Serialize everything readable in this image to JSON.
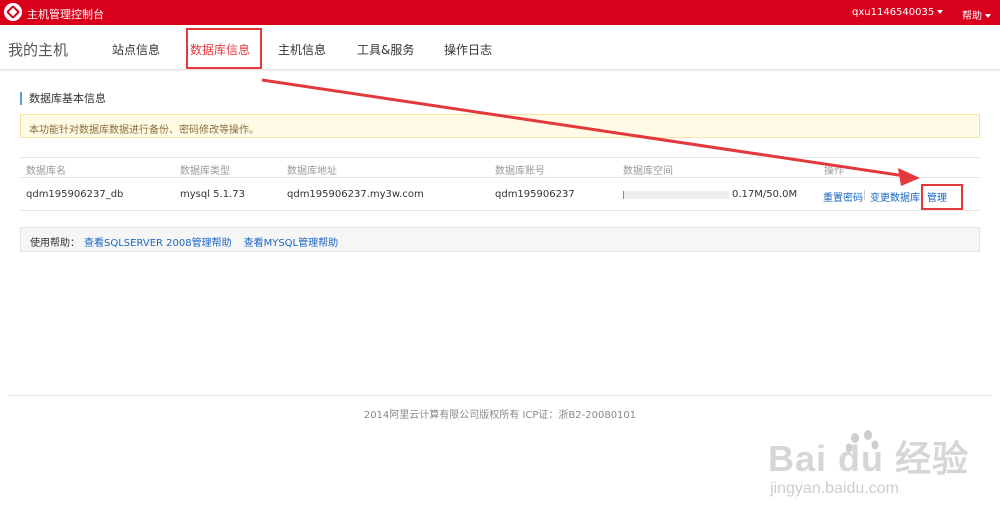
{
  "topbar": {
    "title": "主机管理控制台",
    "user": "qxu1146540035",
    "help": "帮助"
  },
  "nav": {
    "brand": "我的主机",
    "tabs": [
      {
        "label": "站点信息"
      },
      {
        "label": "数据库信息",
        "active": true
      },
      {
        "label": "主机信息"
      },
      {
        "label": "工具&服务"
      },
      {
        "label": "操作日志"
      }
    ]
  },
  "section": {
    "title": "数据库基本信息",
    "notice": "本功能针对数据库数据进行备份、密码修改等操作。"
  },
  "table": {
    "headers": [
      "数据库名",
      "数据库类型",
      "数据库地址",
      "数据库账号",
      "数据库空间",
      "操作"
    ],
    "row": {
      "name": "qdm195906237_db",
      "type": "mysql 5.1.73",
      "address": "qdm195906237.my3w.com",
      "account": "qdm195906237",
      "space_text": "0.17M/50.0M",
      "space_used_fraction": 0.0034,
      "ops": [
        "重置密码",
        "变更数据库",
        "管理"
      ]
    }
  },
  "helpbar": {
    "label": "使用帮助：",
    "links": [
      "查看SQLSERVER 2008管理帮助",
      "查看MYSQL管理帮助"
    ]
  },
  "footer": "2014阿里云计算有限公司版权所有 ICP证：浙B2-20080101",
  "watermark": {
    "main": "Bai du 经验",
    "sub": "jingyan.baidu.com"
  },
  "colors": {
    "topbar": "#d9001b",
    "annotation": "#e4393c",
    "link": "#1a66c4"
  }
}
